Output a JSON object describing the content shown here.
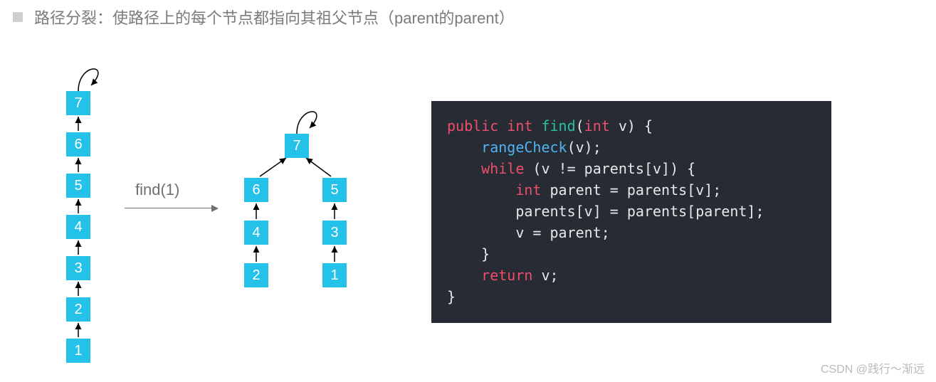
{
  "title": "路径分裂：使路径上的每个节点都指向其祖父节点（parent的parent）",
  "find_label": "find(1)",
  "left_chain": [
    "7",
    "6",
    "5",
    "4",
    "3",
    "2",
    "1"
  ],
  "right_tree": {
    "root": "7",
    "left_branch": [
      "6",
      "4",
      "2"
    ],
    "right_branch": [
      "5",
      "3",
      "1"
    ]
  },
  "code": {
    "l1_public": "public",
    "l1_int": "int",
    "l1_find": "find",
    "l1_int2": "int",
    "l1_v": " v) {",
    "l2_range": "rangeCheck",
    "l2_tail": "(v);",
    "l3_while": "while",
    "l3_cond": " (v != parents[v]) {",
    "l4_int": "int",
    "l4_rest": " parent = parents[v];",
    "l5": "parents[v] = parents[parent];",
    "l6": "v = parent;",
    "l7": "}",
    "l8_return": "return",
    "l8_v": " v;",
    "l9": "}"
  },
  "watermark": "CSDN @践行～渐远"
}
